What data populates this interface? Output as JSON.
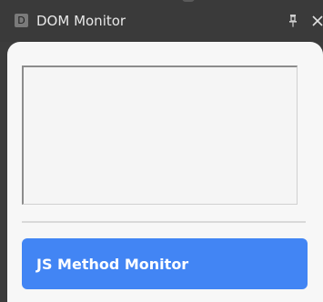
{
  "window": {
    "title": "DOM Monitor",
    "app_icon_letter": "D",
    "pin_icon": "pin-icon",
    "close_icon": "close-icon"
  },
  "main": {
    "textarea_value": "",
    "button_label": "JS Method Monitor"
  },
  "colors": {
    "titlebar": "#3a3a3a",
    "panel_background": "#f7f7f7",
    "button_accent": "#4285f4"
  }
}
